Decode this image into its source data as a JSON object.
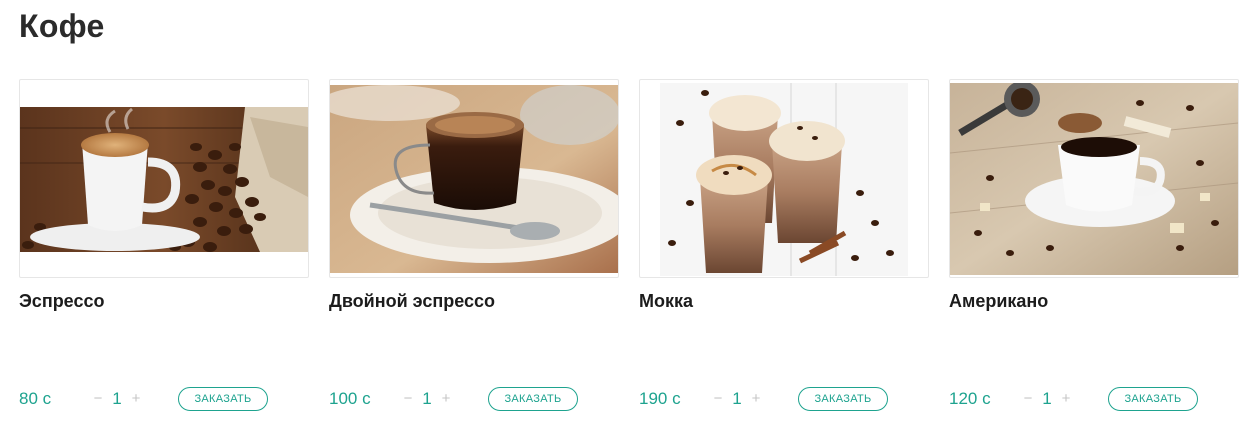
{
  "page": {
    "title": "Кофе"
  },
  "products": [
    {
      "name": "Эспрессо",
      "price": "80 с",
      "quantity": "1",
      "minus": "−",
      "plus": "+",
      "order_label": "ЗАКАЗАТЬ",
      "image": "espresso-cup-with-beans-photo"
    },
    {
      "name": "Двойной эспрессо",
      "price": "100 с",
      "quantity": "1",
      "minus": "−",
      "plus": "+",
      "order_label": "ЗАКАЗАТЬ",
      "image": "double-espresso-glass-cup-photo"
    },
    {
      "name": "Мокка",
      "price": "190 с",
      "quantity": "1",
      "minus": "−",
      "plus": "+",
      "order_label": "ЗАКАЗАТЬ",
      "image": "mocha-glasses-with-cream-photo"
    },
    {
      "name": "Американо",
      "price": "120 с",
      "quantity": "1",
      "minus": "−",
      "plus": "+",
      "order_label": "ЗАКАЗАТЬ",
      "image": "americano-cup-on-wooden-table-photo"
    }
  ],
  "colors": {
    "accent": "#1ea38f",
    "text": "#1c1c1c",
    "muted": "#c4c4c4",
    "border": "#e6e6e6"
  }
}
